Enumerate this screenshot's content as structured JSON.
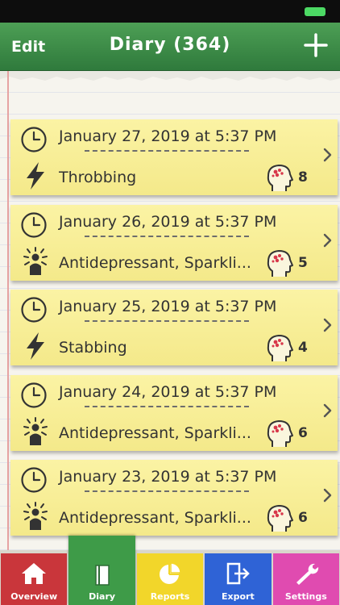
{
  "nav": {
    "edit_label": "Edit",
    "title": "Diary (364)"
  },
  "entries": [
    {
      "date": "January 27, 2019 at 5:37 PM",
      "description": "Throbbing",
      "level": "8",
      "type_icon": "lightning-icon"
    },
    {
      "date": "January 26, 2019 at 5:37 PM",
      "description": "Antidepressant, Sparkli...",
      "level": "5",
      "type_icon": "person-radiating-icon"
    },
    {
      "date": "January 25, 2019 at 5:37 PM",
      "description": "Stabbing",
      "level": "4",
      "type_icon": "lightning-icon"
    },
    {
      "date": "January 24, 2019 at 5:37 PM",
      "description": "Antidepressant, Sparkli...",
      "level": "6",
      "type_icon": "person-radiating-icon"
    },
    {
      "date": "January 23, 2019 at 5:37 PM",
      "description": "Antidepressant, Sparkli...",
      "level": "6",
      "type_icon": "person-radiating-icon"
    }
  ],
  "tabs": [
    {
      "label": "Overview",
      "icon": "house-icon",
      "color": "#c9363b"
    },
    {
      "label": "Diary",
      "icon": "book-icon",
      "color": "#3e9b48"
    },
    {
      "label": "Reports",
      "icon": "pie-chart-icon",
      "color": "#f2d62a"
    },
    {
      "label": "Export",
      "icon": "export-icon",
      "color": "#2f63d6"
    },
    {
      "label": "Settings",
      "icon": "wrench-icon",
      "color": "#e04bb0"
    }
  ],
  "colors": {
    "nav_green": "#3a8a45",
    "note_yellow": "#f7ee95",
    "margin_red": "#e6a3a3"
  }
}
